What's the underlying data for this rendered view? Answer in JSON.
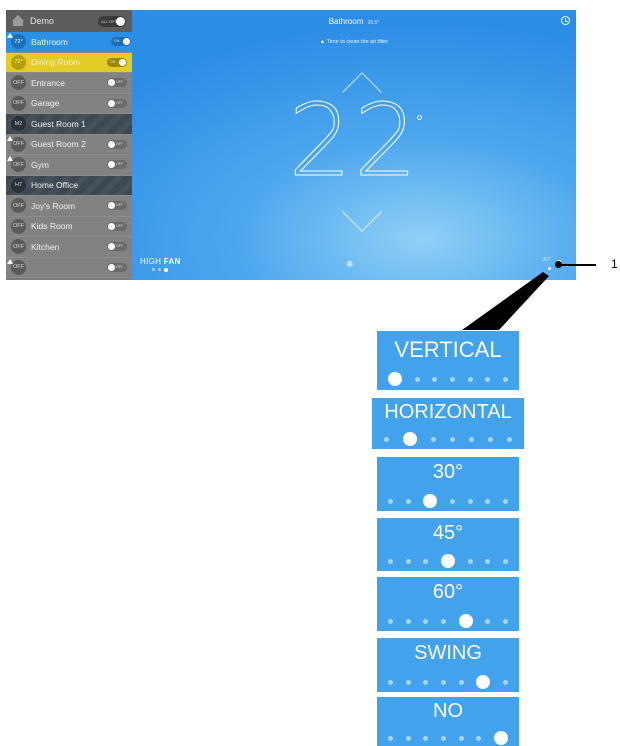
{
  "sidebar": {
    "header": {
      "label": "Demo",
      "toggle_label": "ALL OFF"
    },
    "rooms": [
      {
        "badge": "72°",
        "name": "Bathroom",
        "toggle": "ON",
        "state": "active"
      },
      {
        "badge": "72°",
        "name": "Dining Room",
        "toggle": "ON",
        "state": "yellow"
      },
      {
        "badge": "OFF",
        "name": "Entrance",
        "toggle": "OFF",
        "state": "off"
      },
      {
        "badge": "OFF",
        "name": "Garage",
        "toggle": "OFF",
        "state": "off"
      },
      {
        "badge": "M2",
        "name": "Guest Room 1",
        "toggle": "",
        "state": "striped"
      },
      {
        "badge": "OFF",
        "name": "Guest Room 2",
        "toggle": "OFF",
        "state": "off"
      },
      {
        "badge": "OFF",
        "name": "Gym",
        "toggle": "OFF",
        "state": "off"
      },
      {
        "badge": "H7",
        "name": "Home Office",
        "toggle": "",
        "state": "striped"
      },
      {
        "badge": "OFF",
        "name": "Joy's Room",
        "toggle": "OFF",
        "state": "off"
      },
      {
        "badge": "OFF",
        "name": "Kids Room",
        "toggle": "OFF",
        "state": "off"
      },
      {
        "badge": "OFF",
        "name": "Kitchen",
        "toggle": "OFF",
        "state": "off"
      },
      {
        "badge": "OFF",
        "name": "",
        "toggle": "OFF",
        "state": "off"
      }
    ]
  },
  "main": {
    "title": "Bathroom",
    "title_indicator": "26.5°",
    "filter_message": "▲ Time to clean the air filter",
    "temperature": "22",
    "fan_speed": "HIGH",
    "fan_label": "FAN",
    "fan_level": {
      "count": 3,
      "selected": 3
    },
    "mode_icon": "❄",
    "swing_indicator": "30°"
  },
  "callout": {
    "number": "1"
  },
  "swing_options": [
    {
      "label": "VERTICAL",
      "selected_index": 0
    },
    {
      "label": "HORIZONTAL",
      "selected_index": 1
    },
    {
      "label": "30°",
      "selected_index": 2
    },
    {
      "label": "45°",
      "selected_index": 3
    },
    {
      "label": "60°",
      "selected_index": 4
    },
    {
      "label": "SWING",
      "selected_index": 5
    },
    {
      "label": "NO",
      "selected_index": 6
    }
  ],
  "swing_positions_count": 7,
  "colors": {
    "accent": "#2a90e6",
    "card": "#42a2ec",
    "sidebar": "#828282",
    "highlight": "#e3cc25"
  }
}
